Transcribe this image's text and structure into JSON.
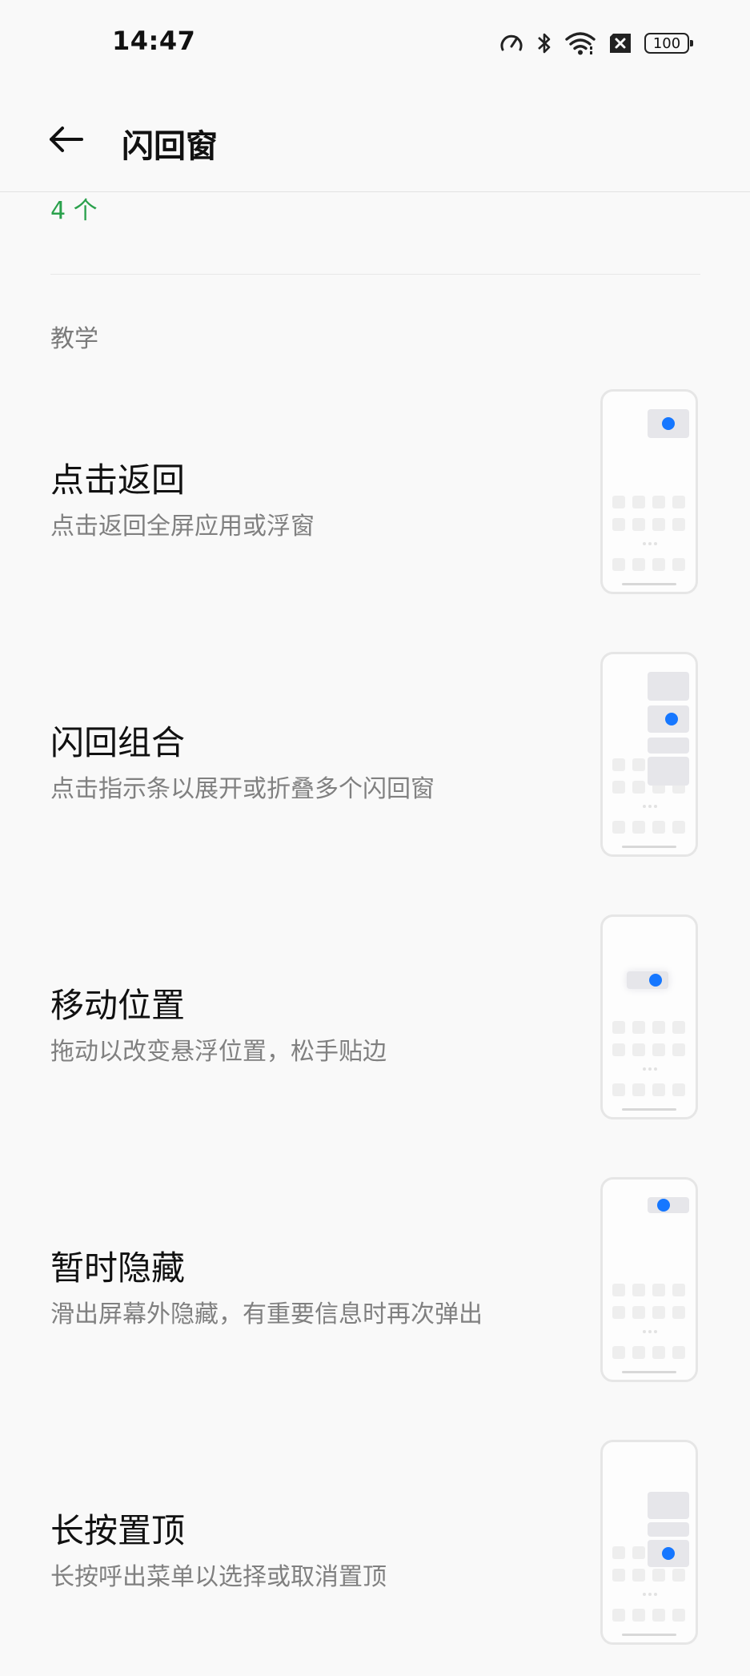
{
  "status_bar": {
    "time": "14:47",
    "icons": [
      "speedometer-icon",
      "bluetooth-icon",
      "wifi-icon",
      "sim-off-icon",
      "battery-icon"
    ],
    "battery_level": "100"
  },
  "header": {
    "back_icon": "arrow-left-icon",
    "title": "闪回窗"
  },
  "count": "4 个",
  "section_title": "教学",
  "colors": {
    "accent_green": "#2aa14c",
    "accent_blue": "#1677ff",
    "background": "#f9f9f9"
  },
  "tutorials": [
    {
      "title": "点击返回",
      "description": "点击返回全屏应用或浮窗"
    },
    {
      "title": "闪回组合",
      "description": "点击指示条以展开或折叠多个闪回窗"
    },
    {
      "title": "移动位置",
      "description": "拖动以改变悬浮位置，松手贴边"
    },
    {
      "title": "暂时隐藏",
      "description": "滑出屏幕外隐藏，有重要信息时再次弹出"
    },
    {
      "title": "长按置顶",
      "description": "长按呼出菜单以选择或取消置顶"
    }
  ]
}
